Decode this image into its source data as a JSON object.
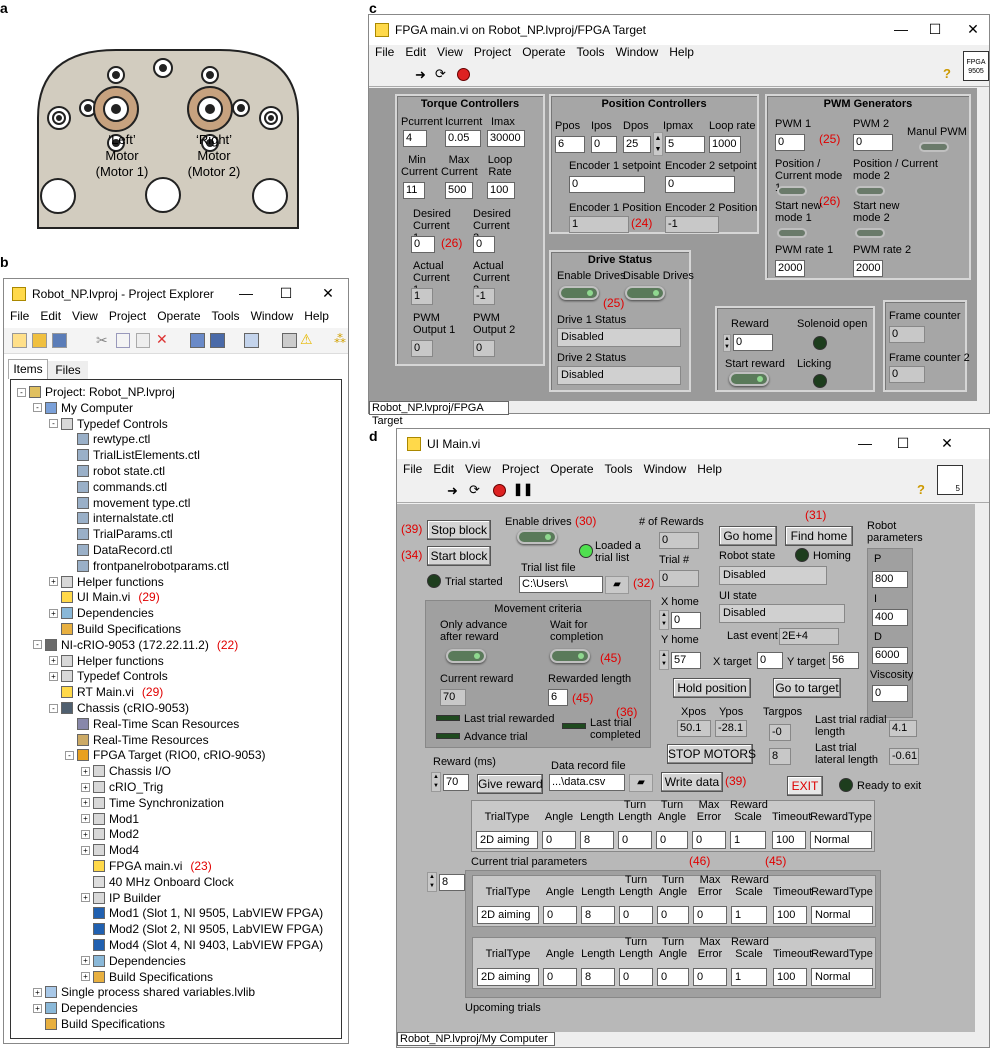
{
  "panel_a": {
    "letter": "a",
    "left_motor": [
      "‘Left’",
      "Motor",
      "(Motor 1)"
    ],
    "right_motor": [
      "‘Right’",
      "Motor",
      "(Motor 2)"
    ]
  },
  "panel_b": {
    "letter": "b",
    "title": "Robot_NP.lvproj - Project Explorer",
    "menu": [
      "File",
      "Edit",
      "View",
      "Project",
      "Operate",
      "Tools",
      "Window",
      "Help"
    ],
    "tabs": [
      "Items",
      "Files"
    ],
    "tree": [
      {
        "text": "Project: Robot_NP.lvproj",
        "icon": "project-icon",
        "depth": 0,
        "expand": "-"
      },
      {
        "text": "My Computer",
        "icon": "computer-icon",
        "depth": 1,
        "expand": "-"
      },
      {
        "text": "Typedef Controls",
        "icon": "folder-icon",
        "depth": 2,
        "expand": "-"
      },
      {
        "text": "rewtype.ctl",
        "icon": "ctl-icon",
        "depth": 3
      },
      {
        "text": "TrialListElements.ctl",
        "icon": "ctl-icon",
        "depth": 3
      },
      {
        "text": "robot state.ctl",
        "icon": "ctl-icon",
        "depth": 3
      },
      {
        "text": "commands.ctl",
        "icon": "ctl-icon",
        "depth": 3
      },
      {
        "text": "movement type.ctl",
        "icon": "ctl-icon",
        "depth": 3
      },
      {
        "text": "internalstate.ctl",
        "icon": "ctl-icon",
        "depth": 3
      },
      {
        "text": "TrialParams.ctl",
        "icon": "ctl-icon",
        "depth": 3
      },
      {
        "text": "DataRecord.ctl",
        "icon": "ctl-icon",
        "depth": 3
      },
      {
        "text": "frontpanelrobotparams.ctl",
        "icon": "ctl-icon",
        "depth": 3
      },
      {
        "text": "Helper functions",
        "icon": "folder-icon",
        "depth": 2,
        "expand": "+"
      },
      {
        "text": "UI Main.vi",
        "icon": "vi-icon",
        "depth": 2,
        "note": "(29)"
      },
      {
        "text": "Dependencies",
        "icon": "dependencies-icon",
        "depth": 2,
        "expand": "+"
      },
      {
        "text": "Build Specifications",
        "icon": "build-icon",
        "depth": 2
      },
      {
        "text": "NI-cRIO-9053 (172.22.11.2)",
        "icon": "target-icon",
        "depth": 1,
        "expand": "-",
        "note": "(22)"
      },
      {
        "text": "Helper functions",
        "icon": "folder-icon",
        "depth": 2,
        "expand": "+"
      },
      {
        "text": "Typedef Controls",
        "icon": "folder-icon",
        "depth": 2,
        "expand": "+"
      },
      {
        "text": "RT Main.vi",
        "icon": "vi-icon",
        "depth": 2,
        "note": "(29)"
      },
      {
        "text": "Chassis (cRIO-9053)",
        "icon": "chassis-icon",
        "depth": 2,
        "expand": "-"
      },
      {
        "text": "Real-Time Scan Resources",
        "icon": "scan-icon",
        "depth": 3
      },
      {
        "text": "Real-Time Resources",
        "icon": "resources-icon",
        "depth": 3
      },
      {
        "text": "FPGA Target (RIO0, cRIO-9053)",
        "icon": "fpga-icon",
        "depth": 3,
        "expand": "-"
      },
      {
        "text": "Chassis I/O",
        "icon": "folder-icon",
        "depth": 4,
        "expand": "+"
      },
      {
        "text": "cRIO_Trig",
        "icon": "folder-icon",
        "depth": 4,
        "expand": "+"
      },
      {
        "text": "Time Synchronization",
        "icon": "folder-icon",
        "depth": 4,
        "expand": "+"
      },
      {
        "text": "Mod1",
        "icon": "folder-icon",
        "depth": 4,
        "expand": "+"
      },
      {
        "text": "Mod2",
        "icon": "folder-icon",
        "depth": 4,
        "expand": "+"
      },
      {
        "text": "Mod4",
        "icon": "folder-icon",
        "depth": 4,
        "expand": "+"
      },
      {
        "text": "FPGA main.vi",
        "icon": "vi-icon",
        "depth": 4,
        "note": "(23)"
      },
      {
        "text": "40 MHz Onboard Clock",
        "icon": "clock-icon",
        "depth": 4
      },
      {
        "text": "IP Builder",
        "icon": "folder-icon",
        "depth": 4,
        "expand": "+"
      },
      {
        "text": "Mod1 (Slot 1, NI 9505, LabVIEW FPGA)",
        "icon": "module-icon",
        "depth": 4
      },
      {
        "text": "Mod2 (Slot 2, NI 9505, LabVIEW FPGA)",
        "icon": "module-icon",
        "depth": 4
      },
      {
        "text": "Mod4 (Slot 4, NI 9403, LabVIEW FPGA)",
        "icon": "module-icon",
        "depth": 4
      },
      {
        "text": "Dependencies",
        "icon": "dependencies-icon",
        "depth": 4,
        "expand": "+"
      },
      {
        "text": "Build Specifications",
        "icon": "build-icon",
        "depth": 4,
        "expand": "+"
      },
      {
        "text": "Single process shared variables.lvlib",
        "icon": "library-icon",
        "depth": 1,
        "expand": "+"
      },
      {
        "text": "Dependencies",
        "icon": "dependencies-icon",
        "depth": 1,
        "expand": "+"
      },
      {
        "text": "Build Specifications",
        "icon": "build-icon",
        "depth": 1
      }
    ]
  },
  "panel_c": {
    "letter": "c",
    "title": "FPGA main.vi on Robot_NP.lvproj/FPGA Target",
    "menu": [
      "File",
      "Edit",
      "View",
      "Project",
      "Operate",
      "Tools",
      "Window",
      "Help"
    ],
    "badge": "FPGA 9505",
    "status": "Robot_NP.lvproj/FPGA Target",
    "torque": {
      "title": "Torque Controllers",
      "labels": {
        "pcurrent": "Pcurrent",
        "icurrent": "Icurrent",
        "imax": "Imax",
        "min_current": "Min Current",
        "max_current": "Max Current",
        "loop_rate": "Loop Rate",
        "desired1": "Desired Current 1",
        "desired2": "Desired Current 2",
        "actual1": "Actual Current 1",
        "actual2": "Actual Current 2",
        "pwm1": "PWM Output 1",
        "pwm2": "PWM Output 2"
      },
      "values": {
        "pcurrent": "4",
        "icurrent": "0.05",
        "imax": "30000",
        "min_current": "11",
        "max_current": "500",
        "loop_rate": "100",
        "desired1": "0",
        "desired2": "0",
        "actual1": "1",
        "actual2": "-1",
        "pwm1": "0",
        "pwm2": "0"
      },
      "note": "(26)"
    },
    "position": {
      "title": "Position Controllers",
      "labels": {
        "ppos": "Ppos",
        "ipos": "Ipos",
        "dpos": "Dpos",
        "ipmax": "Ipmax",
        "loop_rate": "Loop rate",
        "enc1_set": "Encoder 1 setpoint",
        "enc2_set": "Encoder 2 setpoint",
        "enc1_pos": "Encoder 1 Position",
        "enc2_pos": "Encoder 2 Position"
      },
      "values": {
        "ppos": "6",
        "ipos": "0",
        "dpos": "25",
        "ipmax": "5",
        "loop_rate": "1000",
        "enc1_set": "0",
        "enc2_set": "0",
        "enc1_pos": "1",
        "enc2_pos": "-1"
      },
      "note": "(24)"
    },
    "pwm": {
      "title": "PWM Generators",
      "labels": {
        "pwm1": "PWM 1",
        "pwm2": "PWM 2",
        "manual": "Manul PWM",
        "mode1": "Position / Current mode 1",
        "mode2": "Position / Current mode 2",
        "start1": "Start new mode 1",
        "start2": "Start new mode 2",
        "rate1": "PWM rate 1",
        "rate2": "PWM rate 2"
      },
      "values": {
        "pwm1": "0",
        "pwm2": "0",
        "rate1": "2000",
        "rate2": "2000"
      },
      "note1": "(25)",
      "note2": "(26)"
    },
    "drive": {
      "title": "Drive Status",
      "enable": "Enable Drives",
      "disable": "Disable Drives",
      "d1_label": "Drive 1 Status",
      "d1_value": "Disabled",
      "d2_label": "Drive 2 Status",
      "d2_value": "Disabled",
      "note": "(25)"
    },
    "reward": {
      "label": "Reward",
      "value": "0",
      "solenoid": "Solenoid open",
      "start": "Start reward",
      "licking": "Licking"
    },
    "frames": {
      "fc1": "Frame counter",
      "fc1_value": "0",
      "fc2": "Frame counter 2",
      "fc2_value": "0"
    }
  },
  "panel_d": {
    "letter": "d",
    "title": "UI Main.vi",
    "menu": [
      "File",
      "Edit",
      "View",
      "Project",
      "Operate",
      "Tools",
      "Window",
      "Help"
    ],
    "status": "Robot_NP.lvproj/My Computer",
    "badge": "5",
    "stop_block": "Stop block",
    "start_block": "Start block",
    "note39a": "(39)",
    "note34": "(34)",
    "enable_drives": "Enable drives",
    "note30": "(30)",
    "loaded_list": "Loaded a trial list",
    "trial_started": "Trial started",
    "trial_list_file": "Trial list file",
    "trial_list_path": "C:\\Users\\",
    "note32": "(32)",
    "num_rewards_label": "# of Rewards",
    "num_rewards": "0",
    "trial_num_label": "Trial #",
    "trial_num": "0",
    "go_home": "Go home",
    "find_home": "Find home",
    "note31": "(31)",
    "homing": "Homing",
    "robot_state_label": "Robot state",
    "robot_state": "Disabled",
    "ui_state_label": "UI state",
    "ui_state": "Disabled",
    "last_event_label": "Last event",
    "last_event": "2E+4",
    "robot_params": "Robot parameters",
    "p_label": "P",
    "p": "800",
    "i_label": "I",
    "i": "400",
    "d_label": "D",
    "d": "6000",
    "visc_label": "Viscosity",
    "visc": "0",
    "x_home_label": "X home",
    "x_home": "0",
    "y_home_label": "Y home",
    "y_home": "57",
    "x_target_label": "X target",
    "x_target": "0",
    "y_target_label": "Y target",
    "y_target": "56",
    "movement": {
      "title": "Movement criteria",
      "only_advance": "Only advance after reward",
      "wait": "Wait for completion",
      "note45a": "(45)",
      "current_reward_label": "Current reward",
      "current_reward": "70",
      "rewarded_length_label": "Rewarded length",
      "rewarded_length": "6",
      "note45b": "(45)",
      "note36": "(36)",
      "last_trial_rewarded": "Last trial rewarded",
      "last_trial_completed": "Last trial completed",
      "advance_trial": "Advance trial"
    },
    "hold_position": "Hold position",
    "go_to_target": "Go to target",
    "xpos_label": "Xpos",
    "xpos": "50.1",
    "ypos_label": "Ypos",
    "ypos": "-28.1",
    "targpos_label": "Targpos",
    "targpos1": "-0",
    "targpos2": "8",
    "stop_motors": "STOP MOTORS",
    "last_radial_label": "Last trial radial length",
    "last_radial": "4.1",
    "last_lateral_label": "Last trial lateral length",
    "last_lateral": "-0.61",
    "reward_ms_label": "Reward (ms)",
    "reward_ms": "70",
    "give_reward": "Give reward",
    "data_record_label": "Data record file",
    "data_record_path": "...\\data.csv",
    "write_data": "Write data",
    "note39b": "(39)",
    "exit": "EXIT",
    "ready_to_exit": "Ready to exit",
    "table_headers": [
      "TrialType",
      "Angle",
      "Length",
      "Turn Length",
      "Turn Angle",
      "Max Error",
      "Reward Scale",
      "Timeout",
      "RewardType"
    ],
    "current_params_label": "Current trial parameters",
    "note46": "(46)",
    "note45c": "(45)",
    "current_row": [
      "2D aiming",
      "0",
      "8",
      "0",
      "0",
      "0",
      "1",
      "100",
      "Normal"
    ],
    "upcoming_index": "8",
    "upcoming_rows": [
      [
        "2D aiming",
        "0",
        "8",
        "0",
        "0",
        "0",
        "1",
        "100",
        "Normal"
      ],
      [
        "2D aiming",
        "0",
        "8",
        "0",
        "0",
        "0",
        "1",
        "100",
        "Normal"
      ]
    ],
    "upcoming_label": "Upcoming trials"
  }
}
